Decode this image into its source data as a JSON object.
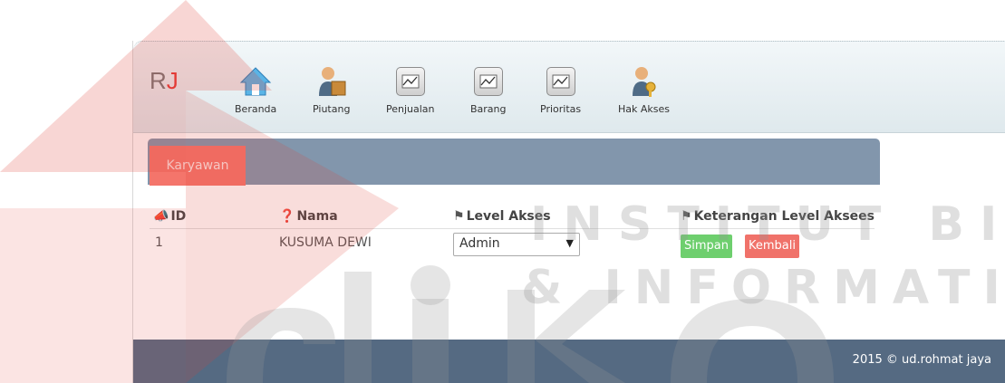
{
  "brand": {
    "text_r": "R",
    "text_j": "J"
  },
  "nav": [
    {
      "label": "Beranda",
      "icon": "home-icon"
    },
    {
      "label": "Piutang",
      "icon": "person-box-icon"
    },
    {
      "label": "Penjualan",
      "icon": "chart-icon"
    },
    {
      "label": "Barang",
      "icon": "chart-icon"
    },
    {
      "label": "Prioritas",
      "icon": "chart-icon"
    },
    {
      "label": "Hak Akses",
      "icon": "user-key-icon"
    }
  ],
  "panel": {
    "tab_label": "Karyawan"
  },
  "table": {
    "headers": [
      "ID",
      "Nama",
      "Level Akses",
      "Keterangan Level Aksees"
    ],
    "rows": [
      {
        "id": "1",
        "nama": "KUSUMA DEWI",
        "level": "Admin"
      }
    ]
  },
  "buttons": {
    "save": "Simpan",
    "back": "Kembali"
  },
  "footer": {
    "copyright": "2015 © ud.rohmat jaya"
  },
  "watermark": {
    "line1": "INSTITUT BISNIS",
    "line2": "& INFORMATIKA"
  },
  "colors": {
    "tab": "#f4756b",
    "panel": "#8296ac",
    "save": "#6ecf6e",
    "back": "#f0726a",
    "footer": "#556a82"
  }
}
